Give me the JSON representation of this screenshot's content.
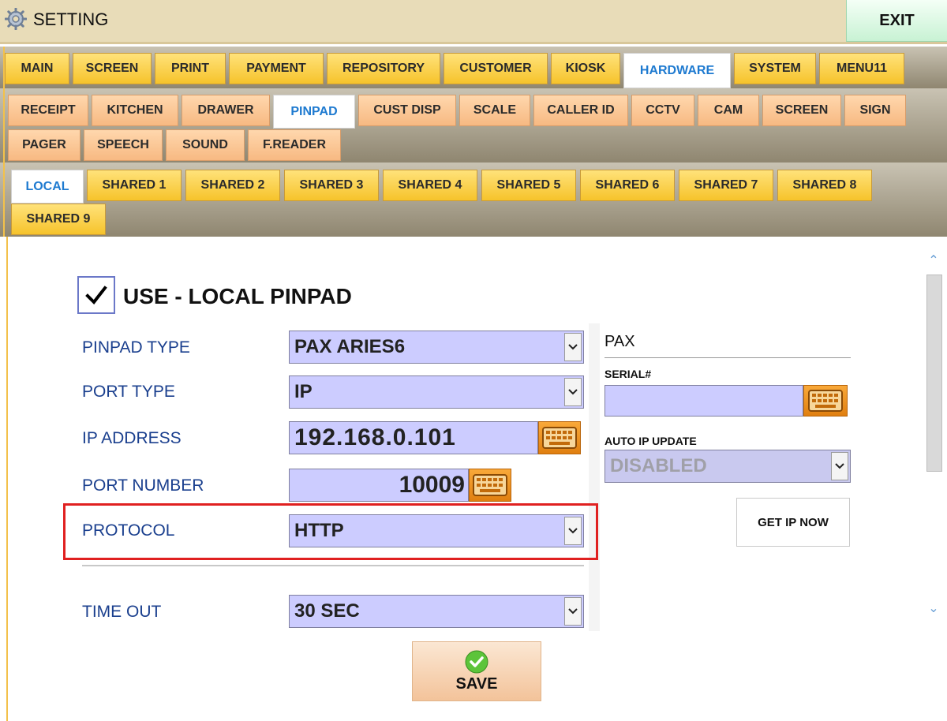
{
  "window": {
    "title": "SETTING",
    "exit_label": "EXIT"
  },
  "main_tabs": [
    "MAIN",
    "SCREEN",
    "PRINT",
    "PAYMENT",
    "REPOSITORY",
    "CUSTOMER",
    "KIOSK",
    "HARDWARE",
    "SYSTEM",
    "MENU11"
  ],
  "main_tabs_active": "HARDWARE",
  "hardware_tabs": [
    "RECEIPT",
    "KITCHEN",
    "DRAWER",
    "PINPAD",
    "CUST DISP",
    "SCALE",
    "CALLER ID",
    "CCTV",
    "CAM",
    "SCREEN",
    "SIGN",
    "PAGER",
    "SPEECH",
    "SOUND",
    "F.READER"
  ],
  "hardware_tabs_active": "PINPAD",
  "device_tabs": [
    "LOCAL",
    "SHARED 1",
    "SHARED 2",
    "SHARED 3",
    "SHARED 4",
    "SHARED 5",
    "SHARED 6",
    "SHARED 7",
    "SHARED 8",
    "SHARED 9"
  ],
  "device_tabs_active": "LOCAL",
  "use_local": {
    "label": "USE - LOCAL PINPAD",
    "checked": true
  },
  "form": {
    "pinpad_type": {
      "label": "PINPAD TYPE",
      "value": "PAX ARIES6"
    },
    "port_type": {
      "label": "PORT TYPE",
      "value": "IP"
    },
    "ip_address": {
      "label": "IP ADDRESS",
      "value": "192.168.0.101"
    },
    "port_number": {
      "label": "PORT NUMBER",
      "value": "10009"
    },
    "protocol": {
      "label": "PROTOCOL",
      "value": "HTTP"
    },
    "time_out": {
      "label": "TIME OUT",
      "value": "30 SEC"
    }
  },
  "pax": {
    "title": "PAX",
    "serial_label": "SERIAL#",
    "serial_value": "",
    "auto_ip_label": "AUTO IP UPDATE",
    "auto_ip_value": "DISABLED",
    "get_ip_label": "GET IP NOW"
  },
  "save_label": "SAVE",
  "colors": {
    "field_bg": "#ccccff",
    "active_tab_text": "#1e7ad0",
    "highlight": "#e02020",
    "label_text": "#1a3f8e"
  }
}
